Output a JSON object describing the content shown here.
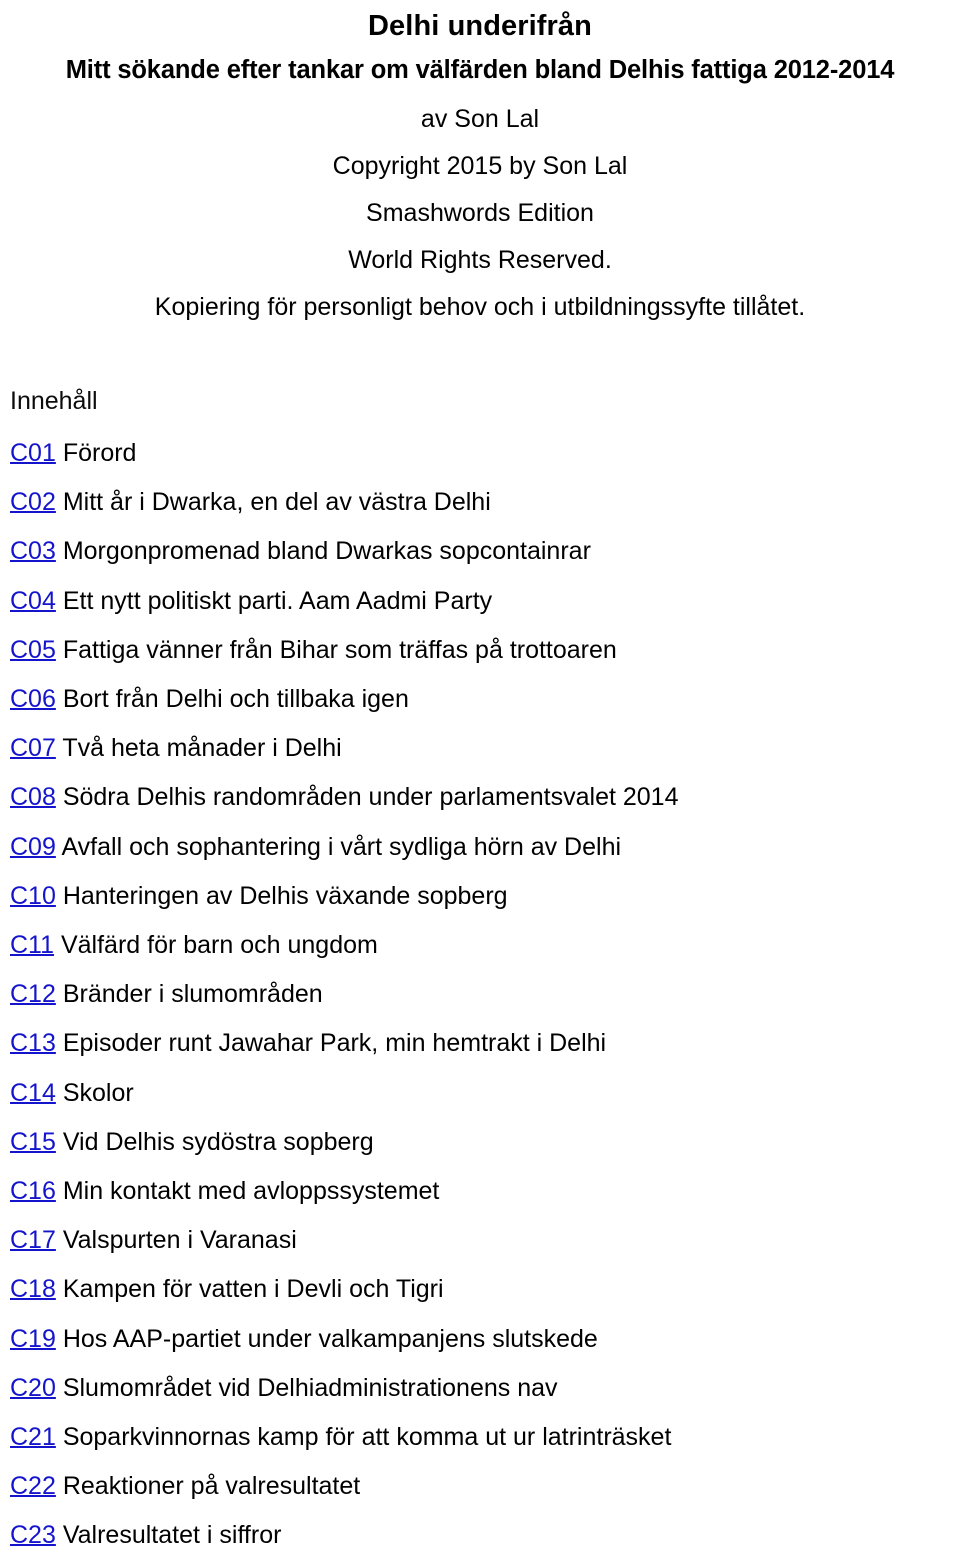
{
  "document": {
    "title": "Delhi underifrån",
    "subtitle": "Mitt sökande efter tankar om välfärden bland Delhis fattiga 2012-2014",
    "author_line": "av Son Lal",
    "copyright_line": "Copyright 2015 by Son Lal",
    "edition_line": "Smashwords Edition",
    "rights_line": "World Rights Reserved.",
    "permission_line": "Kopiering för personligt behov och i utbildningssyfte tillåtet."
  },
  "toc": {
    "heading": "Innehåll",
    "link_color": "#1414cc",
    "text_color": "#000000",
    "entries": [
      {
        "id": "C01",
        "label": "Förord"
      },
      {
        "id": "C02",
        "label": "Mitt år i Dwarka, en del av västra Delhi"
      },
      {
        "id": "C03",
        "label": "Morgonpromenad bland Dwarkas sopcontainrar"
      },
      {
        "id": "C04",
        "label": "Ett nytt politiskt parti. Aam Aadmi Party"
      },
      {
        "id": "C05",
        "label": "Fattiga vänner från Bihar som träffas på trottoaren"
      },
      {
        "id": "C06",
        "label": "Bort från Delhi och tillbaka igen"
      },
      {
        "id": "C07",
        "label": "Två heta månader i Delhi"
      },
      {
        "id": "C08",
        "label": "Södra Delhis randområden under parlamentsvalet 2014"
      },
      {
        "id": "C09",
        "label": "Avfall och sophantering i vårt sydliga hörn av Delhi"
      },
      {
        "id": "C10",
        "label": "Hanteringen av Delhis växande sopberg"
      },
      {
        "id": "C11",
        "label": "Välfärd för barn och ungdom"
      },
      {
        "id": "C12",
        "label": "Bränder i slumområden"
      },
      {
        "id": "C13",
        "label": "Episoder runt Jawahar Park, min hemtrakt i Delhi"
      },
      {
        "id": "C14",
        "label": "Skolor"
      },
      {
        "id": "C15",
        "label": "Vid Delhis sydöstra sopberg"
      },
      {
        "id": "C16",
        "label": "Min kontakt med avloppssystemet"
      },
      {
        "id": "C17",
        "label": "Valspurten i Varanasi"
      },
      {
        "id": "C18",
        "label": "Kampen för vatten i Devli och Tigri"
      },
      {
        "id": "C19",
        "label": "Hos AAP-partiet under valkampanjens slutskede"
      },
      {
        "id": "C20",
        "label": "Slumområdet vid Delhiadministrationens nav"
      },
      {
        "id": "C21",
        "label": "Soparkvinnornas kamp för att komma ut ur latrinträsket"
      },
      {
        "id": "C22",
        "label": "Reaktioner på valresultatet"
      },
      {
        "id": "C23",
        "label": "Valresultatet i siffror"
      }
    ]
  }
}
